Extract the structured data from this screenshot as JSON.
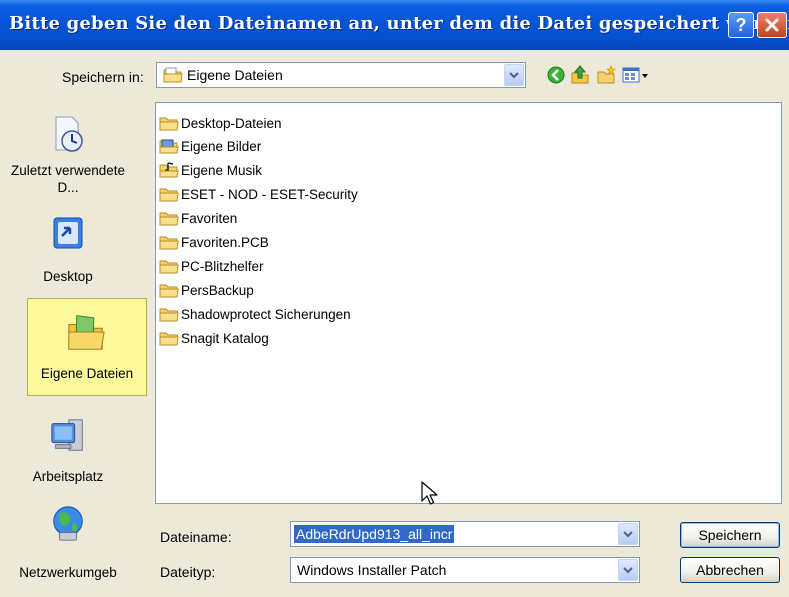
{
  "window": {
    "title": "Bitte geben Sie den Dateinamen an, unter dem die Datei gespeichert werden s...",
    "buttons": {
      "help": "?",
      "close": "close"
    }
  },
  "toolbar": {
    "save_in_label": "Speichern in:",
    "save_in_value": "Eigene Dateien",
    "tools": [
      "back-icon",
      "up-folder-icon",
      "new-folder-icon",
      "view-menu-icon"
    ]
  },
  "places": [
    {
      "label": "Zuletzt verwendete D...",
      "icon": "recent-documents-icon"
    },
    {
      "label": "Desktop",
      "icon": "desktop-icon"
    },
    {
      "label": "Eigene Dateien",
      "icon": "my-documents-icon",
      "selected": true
    },
    {
      "label": "Arbeitsplatz",
      "icon": "my-computer-icon"
    },
    {
      "label": "Netzwerkumgeb",
      "icon": "network-icon"
    }
  ],
  "files": [
    {
      "name": "Desktop-Dateien",
      "icon": "folder-icon"
    },
    {
      "name": "Eigene Bilder",
      "icon": "pictures-folder-icon"
    },
    {
      "name": "Eigene Musik",
      "icon": "music-folder-icon"
    },
    {
      "name": "ESET - NOD - ESET-Security",
      "icon": "folder-icon"
    },
    {
      "name": "Favoriten",
      "icon": "folder-icon"
    },
    {
      "name": "Favoriten.PCB",
      "icon": "folder-icon"
    },
    {
      "name": "PC-Blitzhelfer",
      "icon": "folder-icon"
    },
    {
      "name": "PersBackup",
      "icon": "folder-icon"
    },
    {
      "name": "Shadowprotect Sicherungen",
      "icon": "folder-icon"
    },
    {
      "name": "Snagit Katalog",
      "icon": "folder-icon"
    }
  ],
  "form": {
    "filename_label": "Dateiname:",
    "filename_value": "AdbeRdrUpd913_all_incr",
    "filetype_label": "Dateityp:",
    "filetype_value": "Windows Installer Patch",
    "save_button": "Speichern",
    "cancel_button": "Abbrechen"
  },
  "colors": {
    "titlebar": "#0654d8",
    "selection": "#316ac5",
    "places_selected": "#fcf89c",
    "dialog_bg": "#ece9d8"
  }
}
